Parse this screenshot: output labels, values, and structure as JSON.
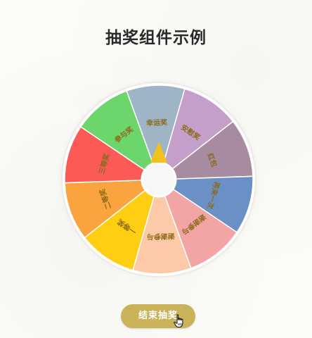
{
  "page": {
    "title": "抽奖组件示例"
  },
  "wheel": {
    "start_angle_deg": -110,
    "segments": [
      {
        "label": "幸运奖",
        "color": "#9fb4c4"
      },
      {
        "label": "安慰奖",
        "color": "#c39fc9"
      },
      {
        "label": "红包",
        "color": "#a78ba0"
      },
      {
        "label": "再来一次",
        "color": "#6b90c6"
      },
      {
        "label": "谢谢参与",
        "color": "#f3a5a5"
      },
      {
        "label": "谢谢参与",
        "color": "#fccaa9"
      },
      {
        "label": "一等奖",
        "color": "#ffcd12"
      },
      {
        "label": "二等奖",
        "color": "#fba43f"
      },
      {
        "label": "三等奖",
        "color": "#fb5a56"
      },
      {
        "label": "参与奖",
        "color": "#6cd66c"
      }
    ],
    "rim_color": "#ffffff",
    "pointer_color": "#f2c21a",
    "label_color": "#8a6a1a",
    "hub_color": "#f7f7f5"
  },
  "action_button": {
    "label": "结束抽奖"
  },
  "icons": {
    "cursor": "hand-pointer-icon"
  }
}
